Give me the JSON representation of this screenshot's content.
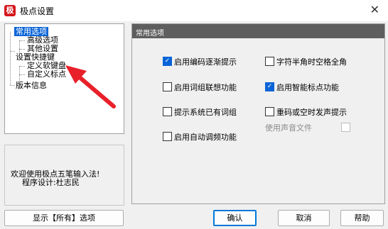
{
  "window": {
    "title": "极点设置",
    "close_glyph": "✕",
    "app_icon_glyph": "极"
  },
  "tree": {
    "items": [
      {
        "label": "常用选项",
        "selected": true
      },
      {
        "label": "高级选项"
      },
      {
        "label": "其他设置"
      },
      {
        "label": "设置快捷键"
      },
      {
        "label": "定义软键盘"
      },
      {
        "label": "自定义标点"
      },
      {
        "label": "版本信息"
      }
    ]
  },
  "info": {
    "line1": "欢迎使用极点五笔输入法!",
    "line2": "程序设计:杜志民"
  },
  "panel": {
    "title": "常用选项",
    "options": [
      {
        "label": "启用编码逐渐提示",
        "checked": true
      },
      {
        "label": "字符半角时空格全角",
        "checked": false
      },
      {
        "label": "启用词组联想功能",
        "checked": false
      },
      {
        "label": "启用智能标点功能",
        "checked": true
      },
      {
        "label": "提示系统已有词组",
        "checked": false
      },
      {
        "label": "重码或空时发声提示",
        "checked": false
      },
      {
        "label": "使用声音文件",
        "checked": false,
        "disabled": true
      },
      {
        "label": "启用自动调频功能",
        "checked": false
      }
    ]
  },
  "buttons": {
    "show_all": "显示【所有】选项",
    "ok": "确认",
    "cancel": "取消",
    "help": "帮助"
  },
  "colors": {
    "arrow": "#e8202a",
    "selection": "#0a64d8",
    "panel_header": "#5e5e5e"
  }
}
